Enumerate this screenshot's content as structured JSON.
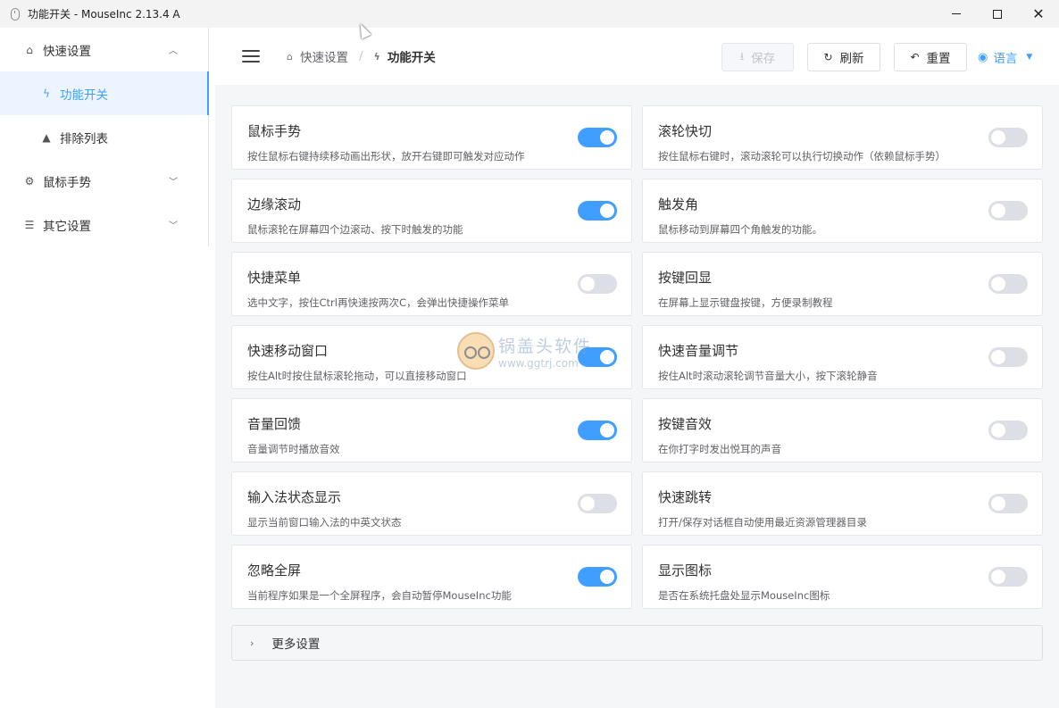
{
  "window": {
    "title": "功能开关 - MouseInc 2.13.4 A",
    "min_icon": "minimize-icon",
    "max_icon": "maximize-icon",
    "close_icon": "close-icon",
    "close_glyph": "✕"
  },
  "sidebar": {
    "items": [
      {
        "label": "快速设置",
        "icon": "home-icon",
        "glyph": "⌂",
        "chevron": "︿"
      },
      {
        "label": "功能开关",
        "icon": "lightning-icon",
        "glyph": "ϟ"
      },
      {
        "label": "排除列表",
        "icon": "warning-icon",
        "glyph": "▲"
      },
      {
        "label": "鼠标手势",
        "icon": "gear-icon",
        "glyph": "⚙",
        "chevron": "﹀"
      },
      {
        "label": "其它设置",
        "icon": "sliders-icon",
        "glyph": "☰",
        "chevron": "﹀"
      }
    ]
  },
  "header": {
    "breadcrumb": [
      {
        "label": "快速设置",
        "icon": "home-icon",
        "glyph": "⌂"
      },
      {
        "label": "功能开关",
        "icon": "lightning-icon",
        "glyph": "ϟ"
      }
    ],
    "separator": "/",
    "save_label": "保存",
    "save_glyph": "⭳",
    "refresh_label": "刷新",
    "refresh_glyph": "↻",
    "reset_label": "重置",
    "reset_glyph": "↶",
    "language_label": "语言",
    "language_glyph": "◉",
    "language_caret": "▼"
  },
  "features": [
    {
      "title": "鼠标手势",
      "desc": "按住鼠标右键持续移动画出形状，放开右键即可触发对应动作",
      "on": true
    },
    {
      "title": "滚轮快切",
      "desc": "按住鼠标右键时，滚动滚轮可以执行切换动作（依赖鼠标手势）",
      "on": false
    },
    {
      "title": "边缘滚动",
      "desc": "鼠标滚轮在屏幕四个边滚动、按下时触发的功能",
      "on": true
    },
    {
      "title": "触发角",
      "desc": "鼠标移动到屏幕四个角触发的功能。",
      "on": false
    },
    {
      "title": "快捷菜单",
      "desc": "选中文字，按住Ctrl再快速按两次C，会弹出快捷操作菜单",
      "on": false
    },
    {
      "title": "按键回显",
      "desc": "在屏幕上显示键盘按键，方便录制教程",
      "on": false
    },
    {
      "title": "快速移动窗口",
      "desc": "按住Alt时按住鼠标滚轮拖动，可以直接移动窗口",
      "on": true
    },
    {
      "title": "快速音量调节",
      "desc": "按住Alt时滚动滚轮调节音量大小，按下滚轮静音",
      "on": false
    },
    {
      "title": "音量回馈",
      "desc": "音量调节时播放音效",
      "on": true
    },
    {
      "title": "按键音效",
      "desc": "在你打字时发出悦耳的声音",
      "on": false
    },
    {
      "title": "输入法状态显示",
      "desc": "显示当前窗口输入法的中英文状态",
      "on": false
    },
    {
      "title": "快速跳转",
      "desc": "打开/保存对话框自动使用最近资源管理器目录",
      "on": false
    },
    {
      "title": "忽略全屏",
      "desc": "当前程序如果是一个全屏程序，会自动暂停MouseInc功能",
      "on": true
    },
    {
      "title": "显示图标",
      "desc": "是否在系统托盘处显示MouseInc图标",
      "on": false
    }
  ],
  "more": {
    "label": "更多设置",
    "glyph": "›"
  },
  "watermark": {
    "text": "锅盖头软件",
    "url": "www.ggtrj.com"
  },
  "colors": {
    "accent": "#409eff",
    "toggle_off": "#dcdfe6",
    "background": "#f5f6f7"
  }
}
